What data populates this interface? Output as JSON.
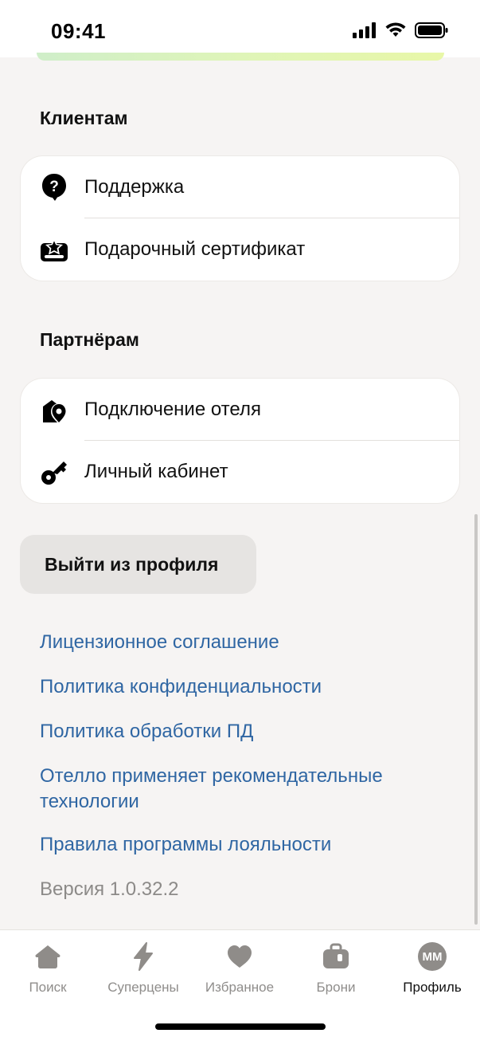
{
  "status": {
    "time": "09:41"
  },
  "clients": {
    "title": "Клиентам",
    "items": [
      {
        "label": "Поддержка",
        "icon": "support-question-icon"
      },
      {
        "label": "Подарочный сертификат",
        "icon": "gift-certificate-icon"
      }
    ]
  },
  "partners": {
    "title": "Партнёрам",
    "items": [
      {
        "label": "Подключение отеля",
        "icon": "hotel-connect-icon"
      },
      {
        "label": "Личный кабинет",
        "icon": "key-icon"
      }
    ]
  },
  "logout": {
    "label": "Выйти из профиля"
  },
  "links": [
    "Лицензионное соглашение",
    "Политика конфиденциальности",
    "Политика обработки ПД",
    "Отелло применяет рекомендательные технологии",
    "Правила программы лояльности"
  ],
  "version": "Версия 1.0.32.2",
  "tabs": [
    {
      "label": "Поиск",
      "icon": "home-icon"
    },
    {
      "label": "Суперцены",
      "icon": "lightning-icon"
    },
    {
      "label": "Избранное",
      "icon": "heart-icon"
    },
    {
      "label": "Брони",
      "icon": "suitcase-icon"
    },
    {
      "label": "Профиль",
      "icon": "avatar",
      "initials": "ММ",
      "active": true
    }
  ],
  "colors": {
    "link": "#2f66a3",
    "muted": "#8c8a88",
    "background": "#f6f4f3",
    "card": "#ffffff"
  }
}
